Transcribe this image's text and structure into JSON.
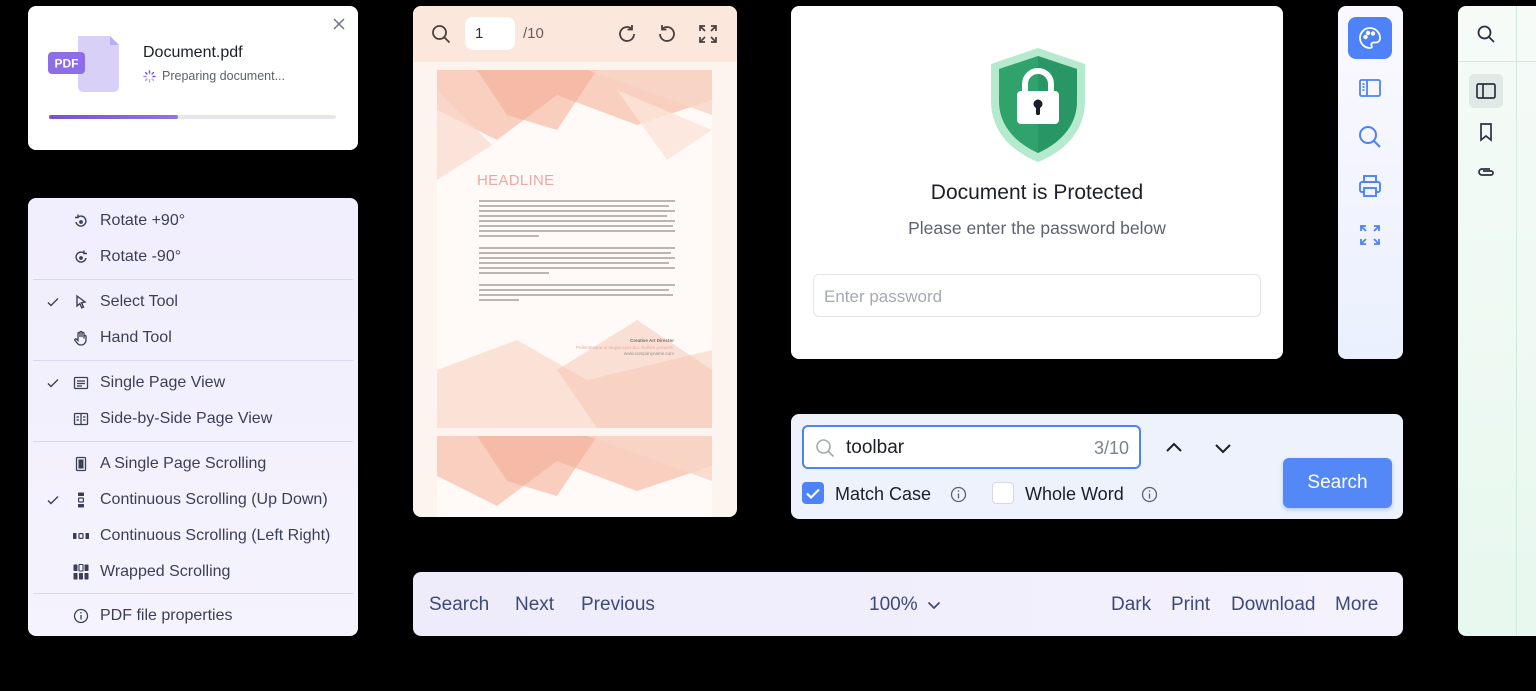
{
  "loading_card": {
    "badge": "PDF",
    "file_name": "Document.pdf",
    "status": "Preparing document...",
    "progress": 0.45
  },
  "context_menu": {
    "items": [
      {
        "label": "Rotate +90°",
        "icon": "rotate-cw-icon",
        "checked": false
      },
      {
        "label": "Rotate -90°",
        "icon": "rotate-ccw-icon",
        "checked": false
      },
      {
        "label": "Select Tool",
        "icon": "cursor-icon",
        "checked": true
      },
      {
        "label": "Hand Tool",
        "icon": "hand-icon",
        "checked": false
      },
      {
        "label": "Single Page View",
        "icon": "single-page-icon",
        "checked": true
      },
      {
        "label": "Side-by-Side Page View",
        "icon": "side-by-side-icon",
        "checked": false
      },
      {
        "label": "A Single Page Scrolling",
        "icon": "single-scroll-icon",
        "checked": false
      },
      {
        "label": "Continuous Scrolling (Up Down)",
        "icon": "vertical-scroll-icon",
        "checked": true
      },
      {
        "label": "Continuous Scrolling (Left Right)",
        "icon": "horizontal-scroll-icon",
        "checked": false
      },
      {
        "label": "Wrapped Scrolling",
        "icon": "wrapped-scroll-icon",
        "checked": false
      },
      {
        "label": "PDF file properties",
        "icon": "info-icon",
        "checked": false
      }
    ]
  },
  "viewer": {
    "page_number": "1",
    "page_total": "/10",
    "letter": {
      "headline": "HEADLINE",
      "signature_title": "Creative Art Director",
      "signature_line": "Pellentesque ut neque iquis dui. Nullam posuere.",
      "signature_web": "www.companyname.com"
    }
  },
  "protected_dialog": {
    "title": "Document is Protected",
    "subtitle": "Please enter the password below",
    "password_placeholder": "Enter password"
  },
  "side_toolbar": {
    "icons": [
      "palette-icon",
      "sidebar-icon",
      "search-icon",
      "print-icon",
      "fullscreen-icon"
    ]
  },
  "search_panel": {
    "query": "toolbar",
    "count": "3/10",
    "match_case_label": "Match Case",
    "match_case_checked": true,
    "whole_word_label": "Whole Word",
    "whole_word_checked": false,
    "search_button": "Search"
  },
  "bottom_toolbar": {
    "search": "Search",
    "next": "Next",
    "previous": "Previous",
    "zoom": "100%",
    "dark": "Dark",
    "print": "Print",
    "download": "Download",
    "more": "More"
  },
  "colors": {
    "accent": "#4d82f8",
    "purple": "#7b4fd6",
    "shield_green": "#2fa36b",
    "viewer_toolbar": "#fce7dc"
  }
}
